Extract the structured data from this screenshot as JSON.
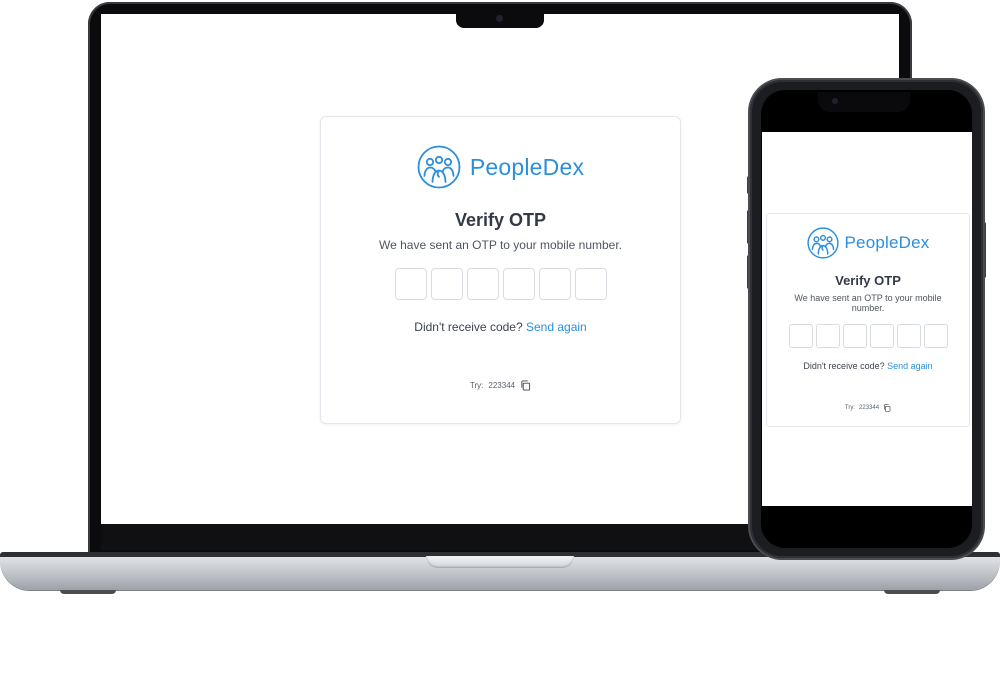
{
  "brand": {
    "name": "PeopleDex",
    "color": "#2b8fdc",
    "logo_icon": "people-group-circle-icon"
  },
  "otp": {
    "title": "Verify OTP",
    "subtitle": "We have sent an OTP to your mobile number.",
    "digits": [
      "",
      "",
      "",
      "",
      "",
      ""
    ],
    "resend_prompt": "Didn't receive code?",
    "resend_link": "Send again",
    "hint_prefix": "Try:",
    "hint_code": "223344",
    "copy_icon": "copy-icon"
  },
  "devices": [
    "laptop",
    "phone"
  ]
}
